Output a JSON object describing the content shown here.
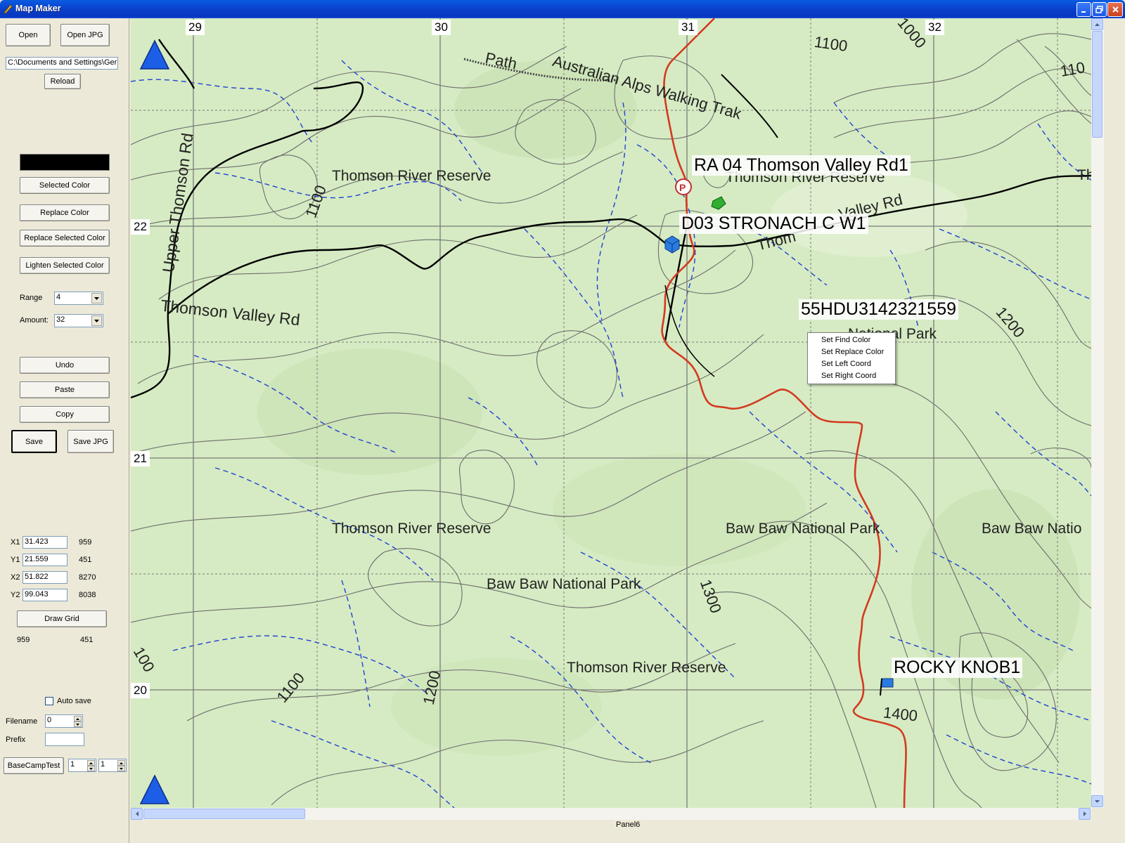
{
  "window": {
    "title": "Map Maker",
    "controls": [
      "minimize-icon",
      "restore-icon",
      "close-icon"
    ]
  },
  "toolbar": {
    "open_label": "Open",
    "open_jpg_label": "Open JPG",
    "path_value": "C:\\Documents and Settings\\Ger",
    "reload_label": "Reload",
    "selected_color_swatch": "#000000",
    "selected_color_label": "Selected Color",
    "replace_color_label": "Replace Color",
    "replace_selected_color_label": "Replace Selected Color",
    "lighten_selected_color_label": "Lighten Selected Color",
    "range_label": "Range",
    "range_value": "4",
    "amount_label": "Amount:",
    "amount_value": "32",
    "undo_label": "Undo",
    "paste_label": "Paste",
    "copy_label": "Copy",
    "save_label": "Save",
    "save_jpg_label": "Save JPG"
  },
  "coords": {
    "x1_label": "X1",
    "x1_value": "31.423",
    "x1_pixel": "959",
    "y1_label": "Y1",
    "y1_value": "21.559",
    "y1_pixel": "451",
    "x2_label": "X2",
    "x2_value": "51.822",
    "x2_pixel": "8270",
    "y2_label": "Y2",
    "y2_value": "99.043",
    "y2_pixel": "8038",
    "draw_grid_label": "Draw Grid",
    "cursor_x": "959",
    "cursor_y": "451"
  },
  "autosave": {
    "label": "Auto save",
    "checked": false,
    "filename_label": "Filename",
    "filename_value": "0",
    "prefix_label": "Prefix",
    "prefix_value": ""
  },
  "basecamp": {
    "button_label": "BaseCampTest",
    "spin1_value": "1",
    "spin2_value": "1"
  },
  "map": {
    "grid_numbers_x": [
      "29",
      "30",
      "31",
      "32"
    ],
    "grid_numbers_y": [
      "22",
      "21",
      "20"
    ],
    "labels": [
      "Thomson River Reserve",
      "Thomson River Reserve",
      "Thomson River Reserve",
      "Thomson River Reserve",
      "Baw Baw National Park",
      "Baw Baw National Park",
      "Baw Baw Natio",
      "National Park",
      "Thomson Valley Rd",
      "Upper Thomson Rd",
      "Australian Alps Walking Trak",
      "Path",
      "Th",
      "Valley Rd",
      "Thom"
    ],
    "contours": [
      "1100",
      "1100",
      "1000",
      "110",
      "1200",
      "1300",
      "1200",
      "1100",
      "1400",
      "100"
    ],
    "waypoints": [
      "RA 04 Thomson Valley Rd1",
      "D03 STRONACH C W1",
      "55HDU3142321559",
      "ROCKY KNOB1"
    ],
    "colors": {
      "background": "#d6ebc3",
      "contour": "#6d6d6d",
      "stream": "#1f3fd6",
      "track": "#d33a20",
      "road": "#000000",
      "grid": "#7a7a7a"
    }
  },
  "context_menu": {
    "items": [
      "Set Find Color",
      "Set Replace Color",
      "Set Left Coord",
      "Set Right Coord"
    ]
  },
  "status": {
    "panel_label": "Panel6"
  }
}
